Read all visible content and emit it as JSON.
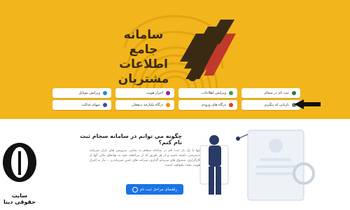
{
  "hero": {
    "title_lines": [
      "سامانه جامع",
      "اطلاعات",
      "مشتریان"
    ],
    "bg_color": "#f2b61c"
  },
  "tiles": [
    {
      "label": "ثبت نام در سجام",
      "icon": "user-icon",
      "color": "#2e7d32"
    },
    {
      "label": "ویرایش اطلاعات",
      "icon": "edit-icon",
      "color": "#43a047"
    },
    {
      "label": "احراز هویت",
      "icon": "id-icon",
      "color": "#8e24aa"
    },
    {
      "label": "ویرایش موبایل",
      "icon": "phone-icon",
      "color": "#1e88e5"
    },
    {
      "label": "بازیابی کد پیگیری",
      "icon": "refresh-icon",
      "color": "#757575"
    },
    {
      "label": "درگاه های ورودی",
      "icon": "gate-icon",
      "color": "#e53935"
    },
    {
      "label": "درگاه یکپارچه ذینفعان",
      "icon": "grid-icon",
      "color": "#fb8c00"
    },
    {
      "label": "سهام عدالت",
      "icon": "share-icon",
      "color": "#3949ab"
    }
  ],
  "section": {
    "question": "چگونه می توانم در سامانه سجام ثبت نام کنم؟",
    "paragraph": "تنها با یک بار ثبت نام در سامانه سجام به تمامی سرویس های بازار سرمایه دسترسی داشته باشید و از هر طریق که از مراجعت خود به نهادهای مالی آنها از کارگزاری، صندوق های سرمایه گذاری، شرکت های تامین سرمایه و ... نیاز به احراز هویت مجدد نخواهید داشت.",
    "guide_button": "راهنمای مراحل ثبت نام"
  },
  "watermark": {
    "text": "سایت حقوقی دینا"
  }
}
